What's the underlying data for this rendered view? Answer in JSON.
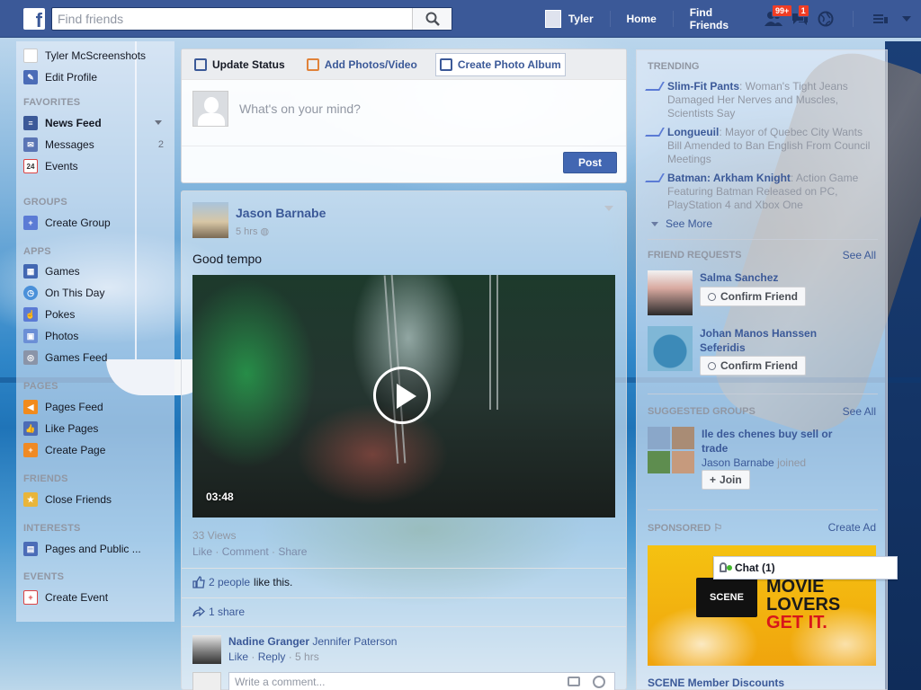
{
  "topbar": {
    "logo": "f",
    "search_placeholder": "Find friends",
    "user_name": "Tyler",
    "home_label": "Home",
    "find_friends_label": "Find Friends",
    "friend_requests_badge": "99+",
    "messages_badge": "1"
  },
  "leftnav": {
    "profile_name": "Tyler McScreenshots",
    "edit_profile": "Edit Profile",
    "favorites_header": "FAVORITES",
    "news_feed": "News Feed",
    "messages": "Messages",
    "messages_count": "2",
    "events": "Events",
    "events_icon_text": "24",
    "groups_header": "GROUPS",
    "create_group": "Create Group",
    "apps_header": "APPS",
    "games": "Games",
    "on_this_day": "On This Day",
    "pokes": "Pokes",
    "photos": "Photos",
    "games_feed": "Games Feed",
    "pages_header": "PAGES",
    "pages_feed": "Pages Feed",
    "like_pages": "Like Pages",
    "create_page": "Create Page",
    "friends_header": "FRIENDS",
    "close_friends": "Close Friends",
    "interests_header": "INTERESTS",
    "pages_public": "Pages and Public ...",
    "events_header": "EVENTS",
    "create_event": "Create Event"
  },
  "composer": {
    "tab_update_status": "Update Status",
    "tab_add_photos": "Add Photos/Video",
    "tab_create_album": "Create Photo Album",
    "placeholder": "What's on your mind?",
    "post_label": "Post"
  },
  "story": {
    "author": "Jason Barnabe",
    "time": "5 hrs",
    "text": "Good tempo",
    "duration": "03:48",
    "views": "33 Views",
    "action_like": "Like",
    "action_comment": "Comment",
    "action_share": "Share",
    "likes_link": "2 people",
    "likes_text": "like this.",
    "shares": "1 share",
    "comment_author1": "Nadine Granger",
    "comment_author2": "Jennifer Paterson",
    "comment_like": "Like",
    "comment_reply": "Reply",
    "comment_time": "5 hrs",
    "write_placeholder": "Write a comment..."
  },
  "trending": {
    "header": "TRENDING",
    "items": [
      {
        "title": "Slim-Fit Pants",
        "desc": ": Woman's Tight Jeans Damaged Her Nerves and Muscles, Scientists Say"
      },
      {
        "title": "Longueuil",
        "desc": ": Mayor of Quebec City Wants Bill Amended to Ban English From Council Meetings"
      },
      {
        "title": "Batman: Arkham Knight",
        "desc": ": Action Game Featuring Batman Released on PC, PlayStation 4 and Xbox One"
      }
    ],
    "see_more": "See More"
  },
  "friend_requests": {
    "header": "FRIEND REQUESTS",
    "see_all": "See All",
    "items": [
      {
        "name": "Salma Sanchez",
        "button": "Confirm Friend"
      },
      {
        "name": "Johan Manos Hanssen Seferidis",
        "button": "Confirm Friend"
      }
    ]
  },
  "suggested_groups": {
    "header": "SUGGESTED GROUPS",
    "see_all": "See All",
    "group_name": "Ile des chenes buy sell or trade",
    "member": "Jason Barnabe",
    "member_suffix": "joined",
    "join_label": "Join"
  },
  "sponsored": {
    "header": "SPONSORED",
    "create_ad": "Create Ad",
    "ad_brand": "SCENE",
    "ad_line1": "MOVIE",
    "ad_line2": "LOVERS",
    "ad_line3": "GET IT.",
    "caption": "SCENE Member Discounts"
  },
  "chat": {
    "label": "Chat (1)"
  }
}
